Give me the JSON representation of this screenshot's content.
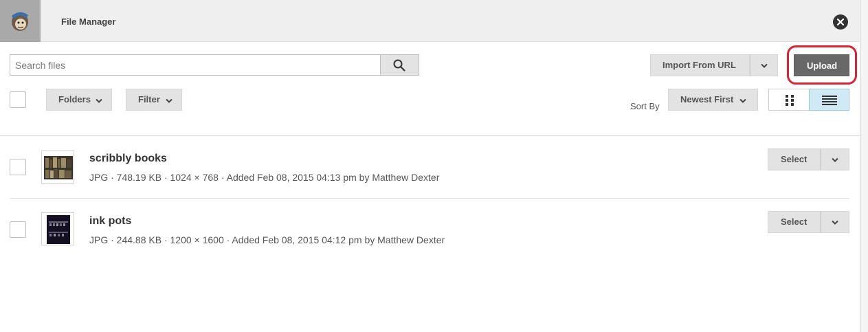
{
  "header": {
    "title": "File Manager",
    "logo_icon": "mailchimp-monkey-icon",
    "close_icon": "close-icon"
  },
  "toolbar": {
    "search_placeholder": "Search files",
    "search_icon": "search-icon",
    "import_label": "Import From URL",
    "upload_label": "Upload",
    "folders_label": "Folders",
    "filter_label": "Filter",
    "sort_by_label": "Sort By",
    "sort_value": "Newest First",
    "view_modes": [
      "grid-view-icon",
      "list-view-icon"
    ],
    "active_view": "list",
    "highlight_color": "#d62433"
  },
  "files": [
    {
      "name": "scribbly books",
      "meta": "JPG · 748.19 KB · 1024 × 768 · Added Feb 08, 2015 04:13 pm by Matthew Dexter",
      "select_label": "Select"
    },
    {
      "name": "ink pots",
      "meta": "JPG · 244.88 KB · 1200 × 1600 · Added Feb 08, 2015 04:12 pm by Matthew Dexter",
      "select_label": "Select"
    }
  ]
}
